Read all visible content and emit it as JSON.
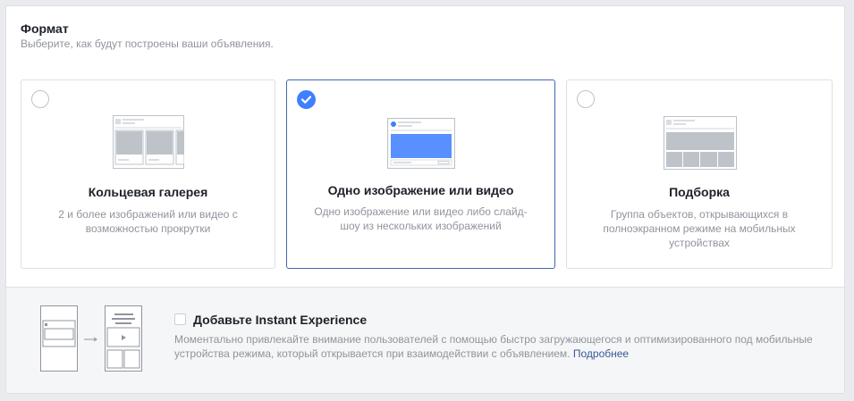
{
  "format": {
    "title": "Формат",
    "subtitle": "Выберите, как будут построены ваши объявления."
  },
  "cards": [
    {
      "title": "Кольцевая галерея",
      "description": "2 и более изображений или видео с возможностью прокрутки",
      "selected": false,
      "icon": "carousel-thumbnail-icon"
    },
    {
      "title": "Одно изображение или видео",
      "description": "Одно изображение или видео либо слайд-шоу из нескольких изображений",
      "selected": true,
      "icon": "single-image-thumbnail-icon"
    },
    {
      "title": "Подборка",
      "description": "Группа объектов, открывающихся в полноэкранном режиме на мобильных устройствах",
      "selected": false,
      "icon": "collection-thumbnail-icon"
    }
  ],
  "instant_experience": {
    "checkbox_checked": false,
    "title": "Добавьте Instant Experience",
    "description": "Моментально привлекайте внимание пользователей с помощью быстро загружающегося и оптимизированного под мобильные устройства режима, который открывается при взаимодействии с объявлением.",
    "link_label": "Подробнее",
    "icon": "instant-experience-illustration-icon"
  },
  "colors": {
    "accent": "#4080ff",
    "selected_border": "#4267b2",
    "link": "#365899",
    "muted_text": "#90949c"
  }
}
